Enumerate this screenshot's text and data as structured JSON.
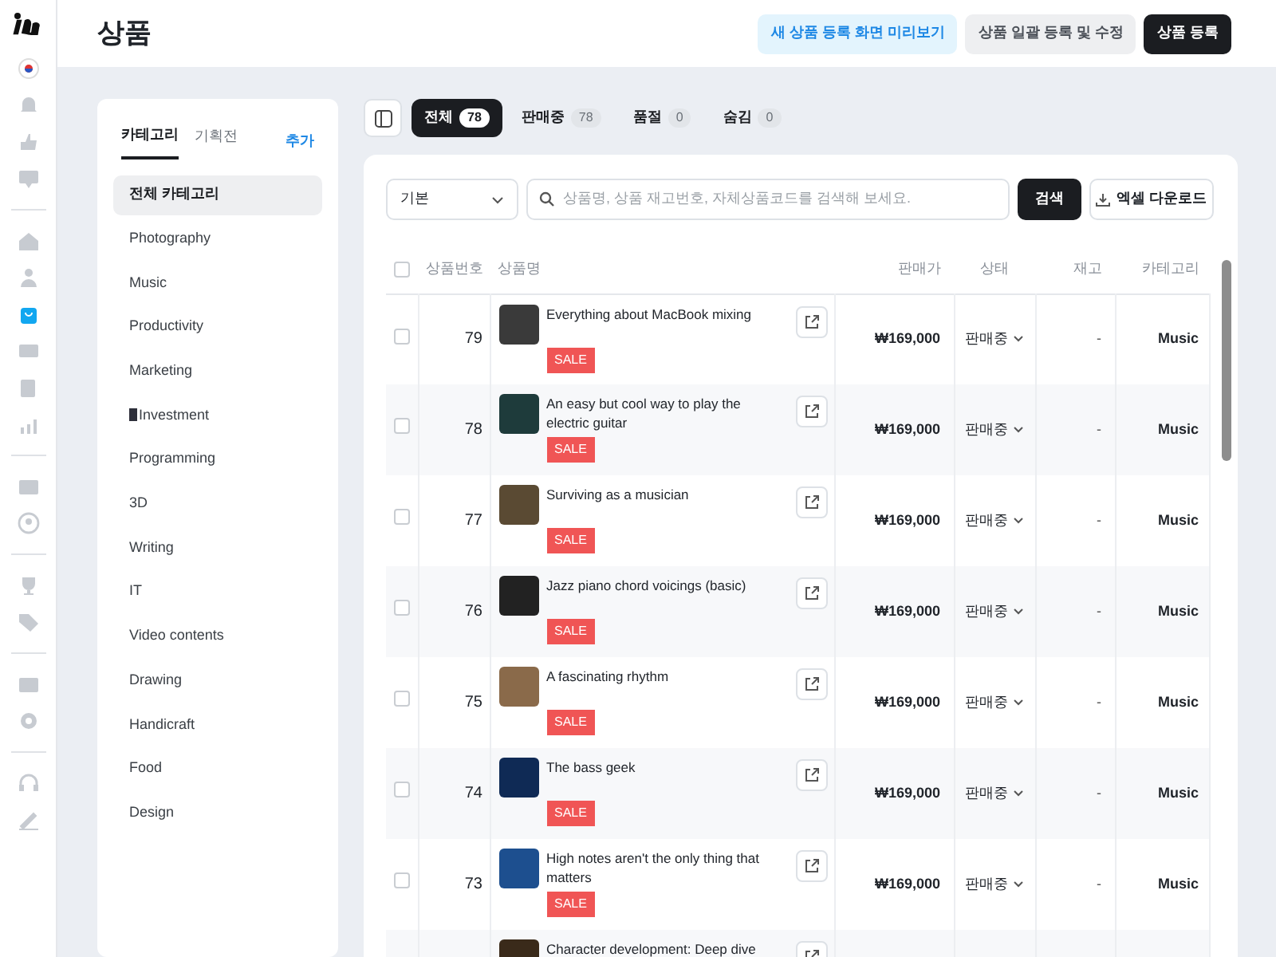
{
  "header": {
    "title": "상품",
    "buttons": [
      {
        "label": "새 상품 등록 화면 미리보기",
        "kind": "info"
      },
      {
        "label": "상품 일괄 등록 및 수정",
        "kind": "secondary"
      },
      {
        "label": "상품 등록",
        "kind": "primary"
      }
    ]
  },
  "rail": {
    "groups": [
      [
        {
          "kind": "flag",
          "selected": false
        },
        {
          "kind": "bell",
          "selected": false
        },
        {
          "kind": "thumb",
          "selected": false
        },
        {
          "kind": "chat",
          "selected": false
        }
      ],
      [
        {
          "kind": "home",
          "selected": false
        },
        {
          "kind": "person",
          "selected": false
        },
        {
          "kind": "bag",
          "selected": true
        },
        {
          "kind": "coupon",
          "selected": false
        },
        {
          "kind": "note",
          "selected": false
        },
        {
          "kind": "chart",
          "selected": false
        }
      ],
      [
        {
          "kind": "inbox",
          "selected": false
        },
        {
          "kind": "user",
          "selected": false
        }
      ],
      [
        {
          "kind": "trophy",
          "selected": false
        },
        {
          "kind": "tag",
          "selected": false
        }
      ],
      [
        {
          "kind": "card",
          "selected": false
        },
        {
          "kind": "gear",
          "selected": false
        }
      ],
      [
        {
          "kind": "headset",
          "selected": false
        },
        {
          "kind": "pen",
          "selected": false
        }
      ]
    ]
  },
  "category_panel": {
    "tabs": [
      {
        "label": "카테고리",
        "selected": true
      },
      {
        "label": "기획전",
        "selected": false
      }
    ],
    "add_link": "추가",
    "items": [
      {
        "label": "전체 카테고리",
        "selected": true
      },
      {
        "label": "Photography",
        "selected": false
      },
      {
        "label": "Music",
        "selected": false
      },
      {
        "label": "Productivity",
        "selected": false
      },
      {
        "label": "Marketing",
        "selected": false
      },
      {
        "label": "Investment",
        "selected": false,
        "icon": true
      },
      {
        "label": "Programming",
        "selected": false
      },
      {
        "label": "3D",
        "selected": false
      },
      {
        "label": "Writing",
        "selected": false
      },
      {
        "label": "IT",
        "selected": false
      },
      {
        "label": "Video contents",
        "selected": false
      },
      {
        "label": "Drawing",
        "selected": false
      },
      {
        "label": "Handicraft",
        "selected": false
      },
      {
        "label": "Food",
        "selected": false
      },
      {
        "label": "Design",
        "selected": false
      }
    ]
  },
  "filter_tabs": [
    {
      "label": "전체",
      "count": "78",
      "selected": true
    },
    {
      "label": "판매중",
      "count": "78",
      "selected": false
    },
    {
      "label": "품절",
      "count": "0",
      "selected": false
    },
    {
      "label": "숨김",
      "count": "0",
      "selected": false
    }
  ],
  "toolbar": {
    "select_value": "기본",
    "search_placeholder": "상품명, 상품 재고번호, 자체상품코드를 검색해 보세요.",
    "search_button": "검색",
    "download_button": "엑셀 다운로드"
  },
  "table": {
    "all_checked": false,
    "columns": [
      "상품번호",
      "상품명",
      "판매가",
      "상태",
      "재고",
      "카테고리"
    ],
    "rows": [
      {
        "checked": false,
        "number": "79",
        "name": "Everything about MacBook mixing",
        "badge": "SALE",
        "price": "₩169,000",
        "status": "판매중",
        "stock": "-",
        "category": "Music"
      },
      {
        "checked": false,
        "number": "78",
        "name": "An easy but cool way to play the electric guitar",
        "badge": "SALE",
        "price": "₩169,000",
        "status": "판매중",
        "stock": "-",
        "category": "Music"
      },
      {
        "checked": false,
        "number": "77",
        "name": "Surviving as a musician",
        "badge": "SALE",
        "price": "₩169,000",
        "status": "판매중",
        "stock": "-",
        "category": "Music"
      },
      {
        "checked": false,
        "number": "76",
        "name": "Jazz piano chord voicings (basic)",
        "badge": "SALE",
        "price": "₩169,000",
        "status": "판매중",
        "stock": "-",
        "category": "Music"
      },
      {
        "checked": false,
        "number": "75",
        "name": "A fascinating rhythm",
        "badge": "SALE",
        "price": "₩169,000",
        "status": "판매중",
        "stock": "-",
        "category": "Music"
      },
      {
        "checked": false,
        "number": "74",
        "name": "The bass geek",
        "badge": "SALE",
        "price": "₩169,000",
        "status": "판매중",
        "stock": "-",
        "category": "Music"
      },
      {
        "checked": false,
        "number": "73",
        "name": "High notes aren't the only thing that matters",
        "badge": "SALE",
        "price": "₩169,000",
        "status": "판매중",
        "stock": "-",
        "category": "Music"
      },
      {
        "name": "Character development: Deep dive"
      }
    ]
  }
}
